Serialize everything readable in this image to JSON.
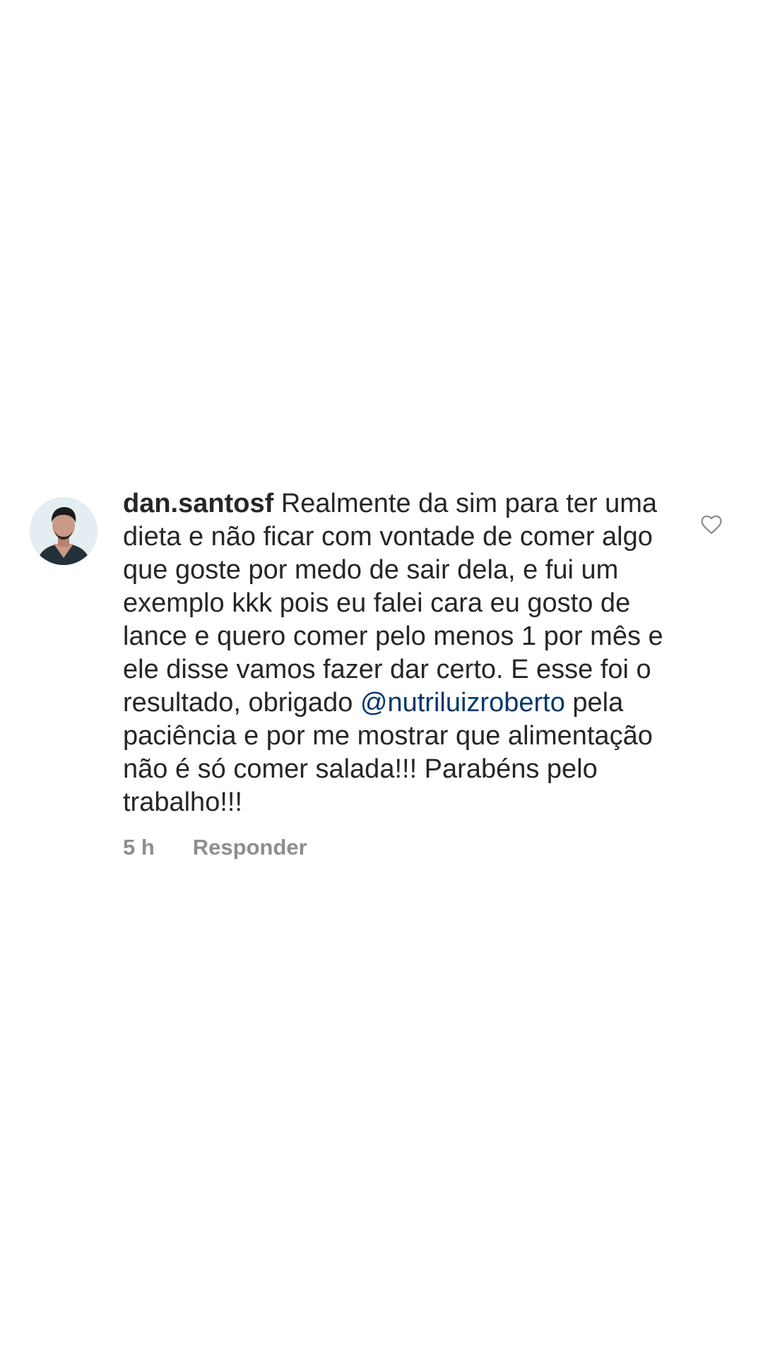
{
  "comment": {
    "username": "dan.santosf",
    "text_before_mention": "Realmente da sim para ter uma dieta e não ficar com vontade de comer algo que goste por medo de sair dela, e fui um exemplo kkk pois eu falei cara eu gosto de lance e quero comer pelo menos 1 por mês e ele disse vamos fazer dar certo. E esse foi o resultado, obrigado",
    "mention": "@nutriluizroberto",
    "text_after_mention": "pela paciência e por me mostrar que alimentação não é só comer salada!!! Parabéns pelo trabalho!!!",
    "time": "5 h",
    "reply_label": "Responder",
    "like_icon": "heart-outline-icon",
    "avatar_icon": "profile-photo"
  },
  "colors": {
    "text": "#262626",
    "mention": "#00376b",
    "meta": "#8e8e8e",
    "background": "#ffffff"
  }
}
